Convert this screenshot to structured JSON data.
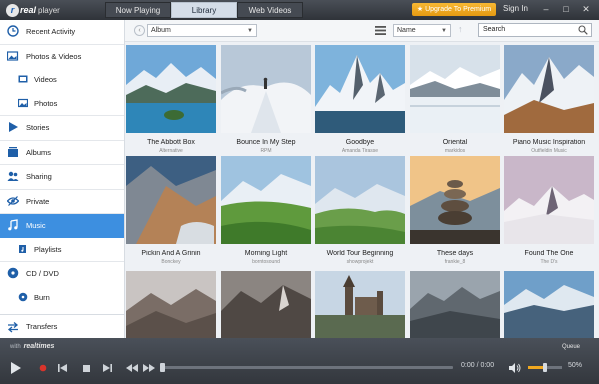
{
  "app": {
    "logo_word": "real",
    "logo_player": "player"
  },
  "tabs": [
    {
      "label": "Now Playing",
      "active": false
    },
    {
      "label": "Library",
      "active": true
    },
    {
      "label": "Web Videos",
      "active": false
    }
  ],
  "header": {
    "upgrade_label": "★ Upgrade To Premium",
    "signin_label": "Sign In"
  },
  "window": {
    "minimize": "–",
    "maximize": "□",
    "close": "✕"
  },
  "sidebar": {
    "items": [
      {
        "label": "Recent Activity",
        "icon": "clock-icon",
        "type": "top"
      },
      {
        "label": "Photos & Videos",
        "icon": "photos-icon",
        "type": "top"
      },
      {
        "label": "Videos",
        "icon": "film-icon",
        "type": "sub"
      },
      {
        "label": "Photos",
        "icon": "image-icon",
        "type": "sub"
      },
      {
        "label": "Stories",
        "icon": "play-stories-icon",
        "type": "top"
      },
      {
        "label": "Albums",
        "icon": "albums-icon",
        "type": "top"
      },
      {
        "label": "Sharing",
        "icon": "users-icon",
        "type": "top"
      },
      {
        "label": "Private",
        "icon": "eye-icon",
        "type": "top"
      },
      {
        "label": "Music",
        "icon": "music-note-icon",
        "type": "top",
        "active": true
      },
      {
        "label": "Playlists",
        "icon": "playlist-icon",
        "type": "sub"
      },
      {
        "label": "CD / DVD",
        "icon": "disc-icon",
        "type": "top"
      },
      {
        "label": "Burn",
        "icon": "burn-icon",
        "type": "sub"
      }
    ],
    "transfers": "Transfers"
  },
  "toolbar": {
    "view_select": "Album",
    "sort_select": "Name",
    "search_value": "Search"
  },
  "albums": [
    {
      "title": "The Abbott Box",
      "artist": "Alternative"
    },
    {
      "title": "Bounce In My Step",
      "artist": "RPM"
    },
    {
      "title": "Goodbye",
      "artist": "Amanda Tirasse"
    },
    {
      "title": "Oriental",
      "artist": "markidos"
    },
    {
      "title": "Piano Music Inspiration",
      "artist": "Outfieldin Music"
    },
    {
      "title": "Pickin And A Grinin",
      "artist": "Bonckey"
    },
    {
      "title": "Morning Light",
      "artist": "borntosound"
    },
    {
      "title": "World Tour Beginning",
      "artist": "showprojekt"
    },
    {
      "title": "These days",
      "artist": "frankie_8"
    },
    {
      "title": "Found The One",
      "artist": "The D's"
    },
    {
      "title": "",
      "artist": ""
    },
    {
      "title": "",
      "artist": ""
    },
    {
      "title": "",
      "artist": ""
    },
    {
      "title": "",
      "artist": ""
    },
    {
      "title": "",
      "artist": ""
    }
  ],
  "player": {
    "with_label": "with",
    "brand": "realtimes",
    "queue": "Queue",
    "time": "0:00 / 0:00",
    "volume_pct": "50%",
    "volume_level": 0.5,
    "progress": 0.0
  }
}
